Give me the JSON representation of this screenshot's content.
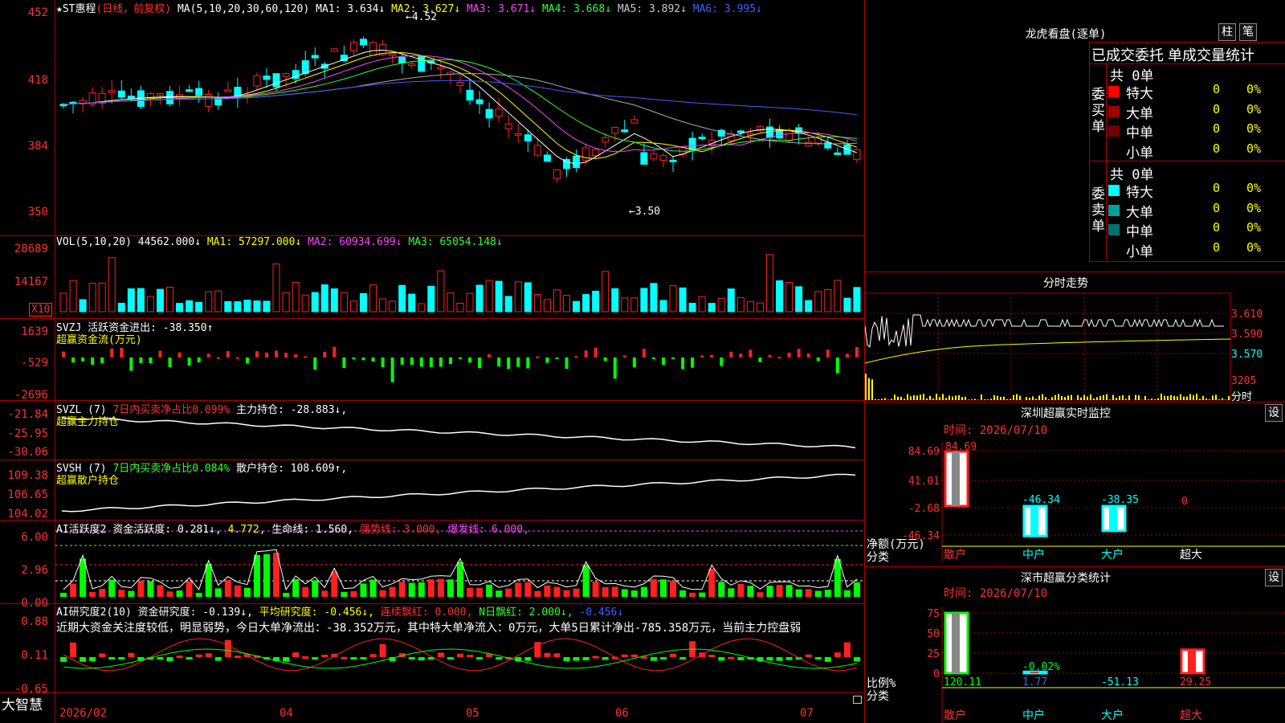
{
  "main": {
    "title": "★ST惠程",
    "mode": "(日线，前复权)",
    "ma_spec": "MA(5,10,20,30,60,120)",
    "ma": [
      {
        "label": "MA1: 3.634↓",
        "color": "#ffffff"
      },
      {
        "label": "MA2: 3.627↓",
        "color": "#ffff00"
      },
      {
        "label": "MA3: 3.671↓",
        "color": "#ff44ff"
      },
      {
        "label": "MA4: 3.668↓",
        "color": "#33ff33"
      },
      {
        "label": "MA5: 3.892↓",
        "color": "#cccccc"
      },
      {
        "label": "MA6: 3.995↓",
        "color": "#4060ff"
      }
    ],
    "yticks": [
      "452",
      "418",
      "384",
      "350"
    ],
    "high_label": "←4.52",
    "low_label": "←3.50"
  },
  "vol": {
    "spec": "VOL(5,10,20)",
    "value": "44562.000↓",
    "ma1": "MA1: 57297.000↓",
    "ma2": "MA2: 60934.699↓",
    "ma3": "MA3: 65054.148↓",
    "yticks": [
      "28689",
      "14167"
    ],
    "unit": "X10"
  },
  "svzj": {
    "name": "SVZJ",
    "line": "活跃资金进出: -38.350↑",
    "sub": "超赢资金流(万元)",
    "yticks": [
      "1639",
      "-529",
      "-2696"
    ]
  },
  "svzl": {
    "name": "SVZL (7)",
    "ratio": "7日内买卖净占比0.099%",
    "hold": "主力持仓: -28.883↓,",
    "sub": "超赢主力持仓",
    "yticks": [
      "-21.84",
      "-25.95",
      "-30.06"
    ]
  },
  "svsh": {
    "name": "SVSH (7)",
    "ratio": "7日内买卖净占比0.084%",
    "hold": "散户持仓: 108.609↑,",
    "sub": "超赢散户持仓",
    "yticks": [
      "109.38",
      "106.65",
      "104.02"
    ]
  },
  "ai1": {
    "name": "AI活跃度2",
    "active": "资金活跃度: 0.281↓,",
    "v2": "4.772,",
    "life": "生命线: 1.560,",
    "strong": "强势线: 3.000,",
    "burst": "爆发线: 6.000,",
    "yticks": [
      "6.00",
      "2.96",
      "0.00"
    ]
  },
  "ai2": {
    "name": "AI研究度2(10)",
    "research": "资金研究度: -0.139↓,",
    "avg": "平均研究度: -0.456↓,",
    "cont": "连续飘红: 0.000,",
    "nday": "N日飘红: 2.000↓,",
    "last": "-0.456↓",
    "comment": "近期大资金关注度较低，明显弱势，今日大单净流出：-38.352万元，其中特大单净流入：0万元，大单5日累计净出-785.358万元，当前主力控盘弱",
    "yticks": [
      "0.88",
      "0.11",
      "-0.65"
    ]
  },
  "dates": [
    "2026/02",
    "04",
    "05",
    "06",
    "07"
  ],
  "brand": "大智慧",
  "longhu": {
    "title": "龙虎看盘(逐单)",
    "btn_zhu": "柱",
    "btn_bi": "笔",
    "tabs": [
      "已成交委托",
      "单成交量统计"
    ],
    "buy_label": "委买单",
    "sell_label": "委卖单",
    "buy_total": "共 0单",
    "sell_total": "共 0单",
    "buy_rows": [
      {
        "name": "特大",
        "v": "0",
        "p": "0%",
        "color": "#ff0000"
      },
      {
        "name": "大单",
        "v": "0",
        "p": "0%",
        "color": "#a00000"
      },
      {
        "name": "中单",
        "v": "0",
        "p": "0%",
        "color": "#700000"
      },
      {
        "name": "小单",
        "v": "0",
        "p": "0%",
        "color": "#000000"
      }
    ],
    "sell_rows": [
      {
        "name": "特大",
        "v": "0",
        "p": "0%",
        "color": "#00ffff"
      },
      {
        "name": "大单",
        "v": "0",
        "p": "0%",
        "color": "#00a0a0"
      },
      {
        "name": "中单",
        "v": "0",
        "p": "0%",
        "color": "#007070"
      },
      {
        "name": "小单",
        "v": "0",
        "p": "0%",
        "color": "#000000"
      }
    ]
  },
  "fenshi": {
    "title": "分时走势",
    "prices": [
      "3.610",
      "3.590",
      "3.570"
    ],
    "vol": "3205",
    "vol_label": "分时"
  },
  "sz_monitor": {
    "title": "深圳超赢实时监控",
    "btn": "设",
    "time": "时间: 2026/07/10",
    "yticks": [
      "84.69",
      "41.01",
      "-2.68",
      "-46.34"
    ],
    "unit1": "净额(万元)",
    "unit2": "分类",
    "bars": [
      {
        "cat": "散户",
        "value": 84.69,
        "label": "84.69"
      },
      {
        "cat": "中户",
        "value": -46.34,
        "label": "-46.34"
      },
      {
        "cat": "大户",
        "value": -38.35,
        "label": "-38.35"
      },
      {
        "cat": "超大",
        "value": 0,
        "label": "0"
      }
    ]
  },
  "sz_class": {
    "title": "深市超赢分类统计",
    "btn": "设",
    "time": "时间: 2026/07/10",
    "yticks": [
      "75",
      "50",
      "25",
      "0"
    ],
    "unit1": "比例%",
    "unit2": "分类",
    "bars": [
      {
        "cat": "散户",
        "value": 120.11,
        "label": "120.11"
      },
      {
        "cat": "中户",
        "value": 1.77,
        "label": "1.77"
      },
      {
        "cat": "大户",
        "value": -51.13,
        "label": "-51.13"
      },
      {
        "cat": "超大",
        "value": 29.25,
        "label": "29.25"
      }
    ],
    "extra": "-0.02%"
  }
}
